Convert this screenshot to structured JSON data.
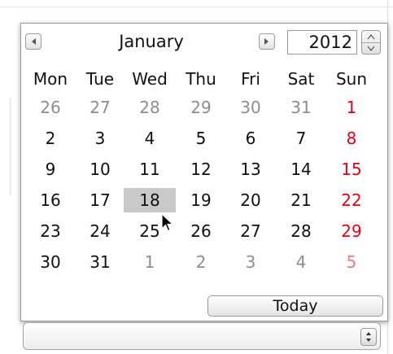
{
  "calendar": {
    "month": "January",
    "year": "2012",
    "weekdays": [
      "Mon",
      "Tue",
      "Wed",
      "Thu",
      "Fri",
      "Sat",
      "Sun"
    ],
    "weeks": [
      [
        {
          "d": "26",
          "other": true
        },
        {
          "d": "27",
          "other": true
        },
        {
          "d": "28",
          "other": true
        },
        {
          "d": "29",
          "other": true
        },
        {
          "d": "30",
          "other": true
        },
        {
          "d": "31",
          "other": true
        },
        {
          "d": "1"
        }
      ],
      [
        {
          "d": "2"
        },
        {
          "d": "3"
        },
        {
          "d": "4"
        },
        {
          "d": "5"
        },
        {
          "d": "6"
        },
        {
          "d": "7"
        },
        {
          "d": "8"
        }
      ],
      [
        {
          "d": "9"
        },
        {
          "d": "10"
        },
        {
          "d": "11"
        },
        {
          "d": "12"
        },
        {
          "d": "13"
        },
        {
          "d": "14"
        },
        {
          "d": "15"
        }
      ],
      [
        {
          "d": "16"
        },
        {
          "d": "17"
        },
        {
          "d": "18",
          "selected": true
        },
        {
          "d": "19"
        },
        {
          "d": "20"
        },
        {
          "d": "21"
        },
        {
          "d": "22"
        }
      ],
      [
        {
          "d": "23"
        },
        {
          "d": "24"
        },
        {
          "d": "25"
        },
        {
          "d": "26"
        },
        {
          "d": "27"
        },
        {
          "d": "28"
        },
        {
          "d": "29"
        }
      ],
      [
        {
          "d": "30"
        },
        {
          "d": "31"
        },
        {
          "d": "1",
          "other": true
        },
        {
          "d": "2",
          "other": true
        },
        {
          "d": "3",
          "other": true
        },
        {
          "d": "4",
          "other": true
        },
        {
          "d": "5",
          "other": true
        }
      ]
    ],
    "today_label": "Today",
    "icons": {
      "prev": "left-arrow-icon",
      "next": "right-arrow-icon",
      "year_stepper": "up-down-stepper-icon",
      "cursor": "mouse-pointer-icon",
      "combo_stepper": "up-down-stepper-icon"
    },
    "colors": {
      "sunday": "#e0001a",
      "other_month": "#8d8d8d",
      "selected_bg": "#c9c9c9"
    }
  }
}
